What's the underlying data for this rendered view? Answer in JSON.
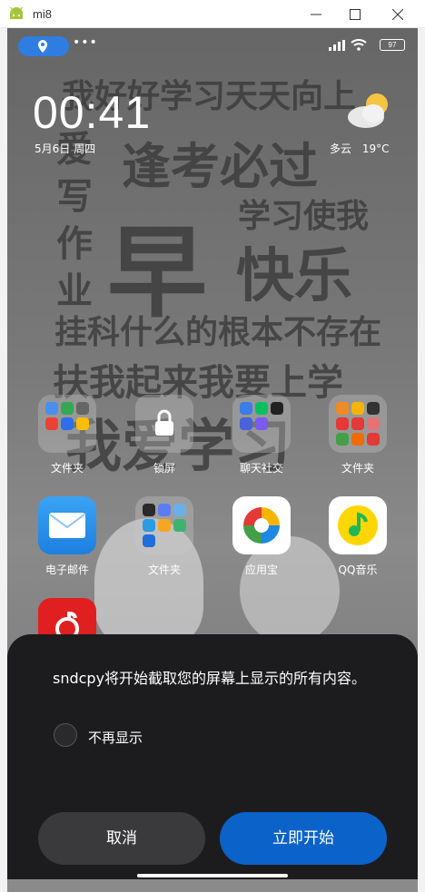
{
  "window": {
    "title": "mi8"
  },
  "status_bar": {
    "dots": "•••",
    "battery": "97"
  },
  "lockscreen": {
    "time": "00:41",
    "date": "5月6日 周四",
    "weather": "多云",
    "temperature": "19°C"
  },
  "wallpaper": {
    "line1": "我好好学习天天向上",
    "line2": "逢考必过",
    "line3": "爱写作业",
    "line4": "早",
    "line5": "学习使我",
    "line6": "快乐",
    "line7": "挂科什么的根本不存在",
    "line8": "扶我起来我要上学",
    "line9": "我爱学习"
  },
  "apps": [
    {
      "label": "文件夹"
    },
    {
      "label": "锁屏"
    },
    {
      "label": "聊天社交"
    },
    {
      "label": "文件夹"
    },
    {
      "label": "电子邮件"
    },
    {
      "label": "文件夹"
    },
    {
      "label": "应用宝"
    },
    {
      "label": "QQ音乐"
    }
  ],
  "dialog": {
    "message": "sndcpy将开始截取您的屏幕上显示的所有内容。",
    "checkbox_label": "不再显示",
    "cancel_label": "取消",
    "start_label": "立即开始"
  },
  "colors": {
    "accent": "#0b62c8",
    "dialog_bg": "#1c1c1e",
    "location_pill": "#2f7de1"
  }
}
